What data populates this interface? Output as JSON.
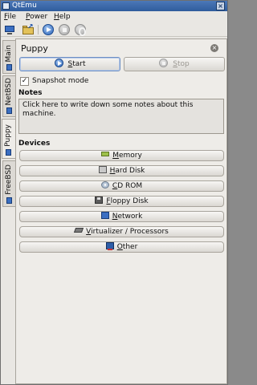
{
  "window": {
    "title": "QtEmu"
  },
  "menu": {
    "items": [
      {
        "key": "F",
        "rest": "ile"
      },
      {
        "key": "P",
        "rest": "ower"
      },
      {
        "key": "H",
        "rest": "elp"
      }
    ]
  },
  "toolbar": {
    "icons": [
      "new-machine-icon",
      "open-machine-icon",
      "start-icon",
      "stop-icon",
      "restart-icon"
    ]
  },
  "tabs": [
    {
      "label": "Main",
      "active": false
    },
    {
      "label": "NetBSD",
      "active": false
    },
    {
      "label": "Puppy",
      "active": true
    },
    {
      "label": "FreeBSD",
      "active": false
    }
  ],
  "machine": {
    "name": "Puppy",
    "start": {
      "key": "S",
      "rest": "tart"
    },
    "stop": {
      "key": "S",
      "rest": "top"
    },
    "snapshot_label": "Snapshot mode",
    "snapshot_checked": "✓",
    "notes_label": "Notes",
    "notes_text": "Click here to write down some notes about this machine.",
    "devices_label": "Devices",
    "devices": [
      {
        "key": "M",
        "rest": "emory",
        "icon": "memory-icon"
      },
      {
        "key": "H",
        "rest": "ard Disk",
        "icon": "hard-disk-icon"
      },
      {
        "key": "C",
        "rest": "D ROM",
        "icon": "cd-rom-icon"
      },
      {
        "key": "F",
        "rest": "loppy Disk",
        "icon": "floppy-disk-icon"
      },
      {
        "key": "N",
        "rest": "etwork",
        "icon": "network-icon"
      },
      {
        "key": "V",
        "rest": "irtualizer / Processors",
        "icon": "processor-icon"
      },
      {
        "key": "O",
        "rest": "ther",
        "icon": "other-icon"
      }
    ]
  }
}
